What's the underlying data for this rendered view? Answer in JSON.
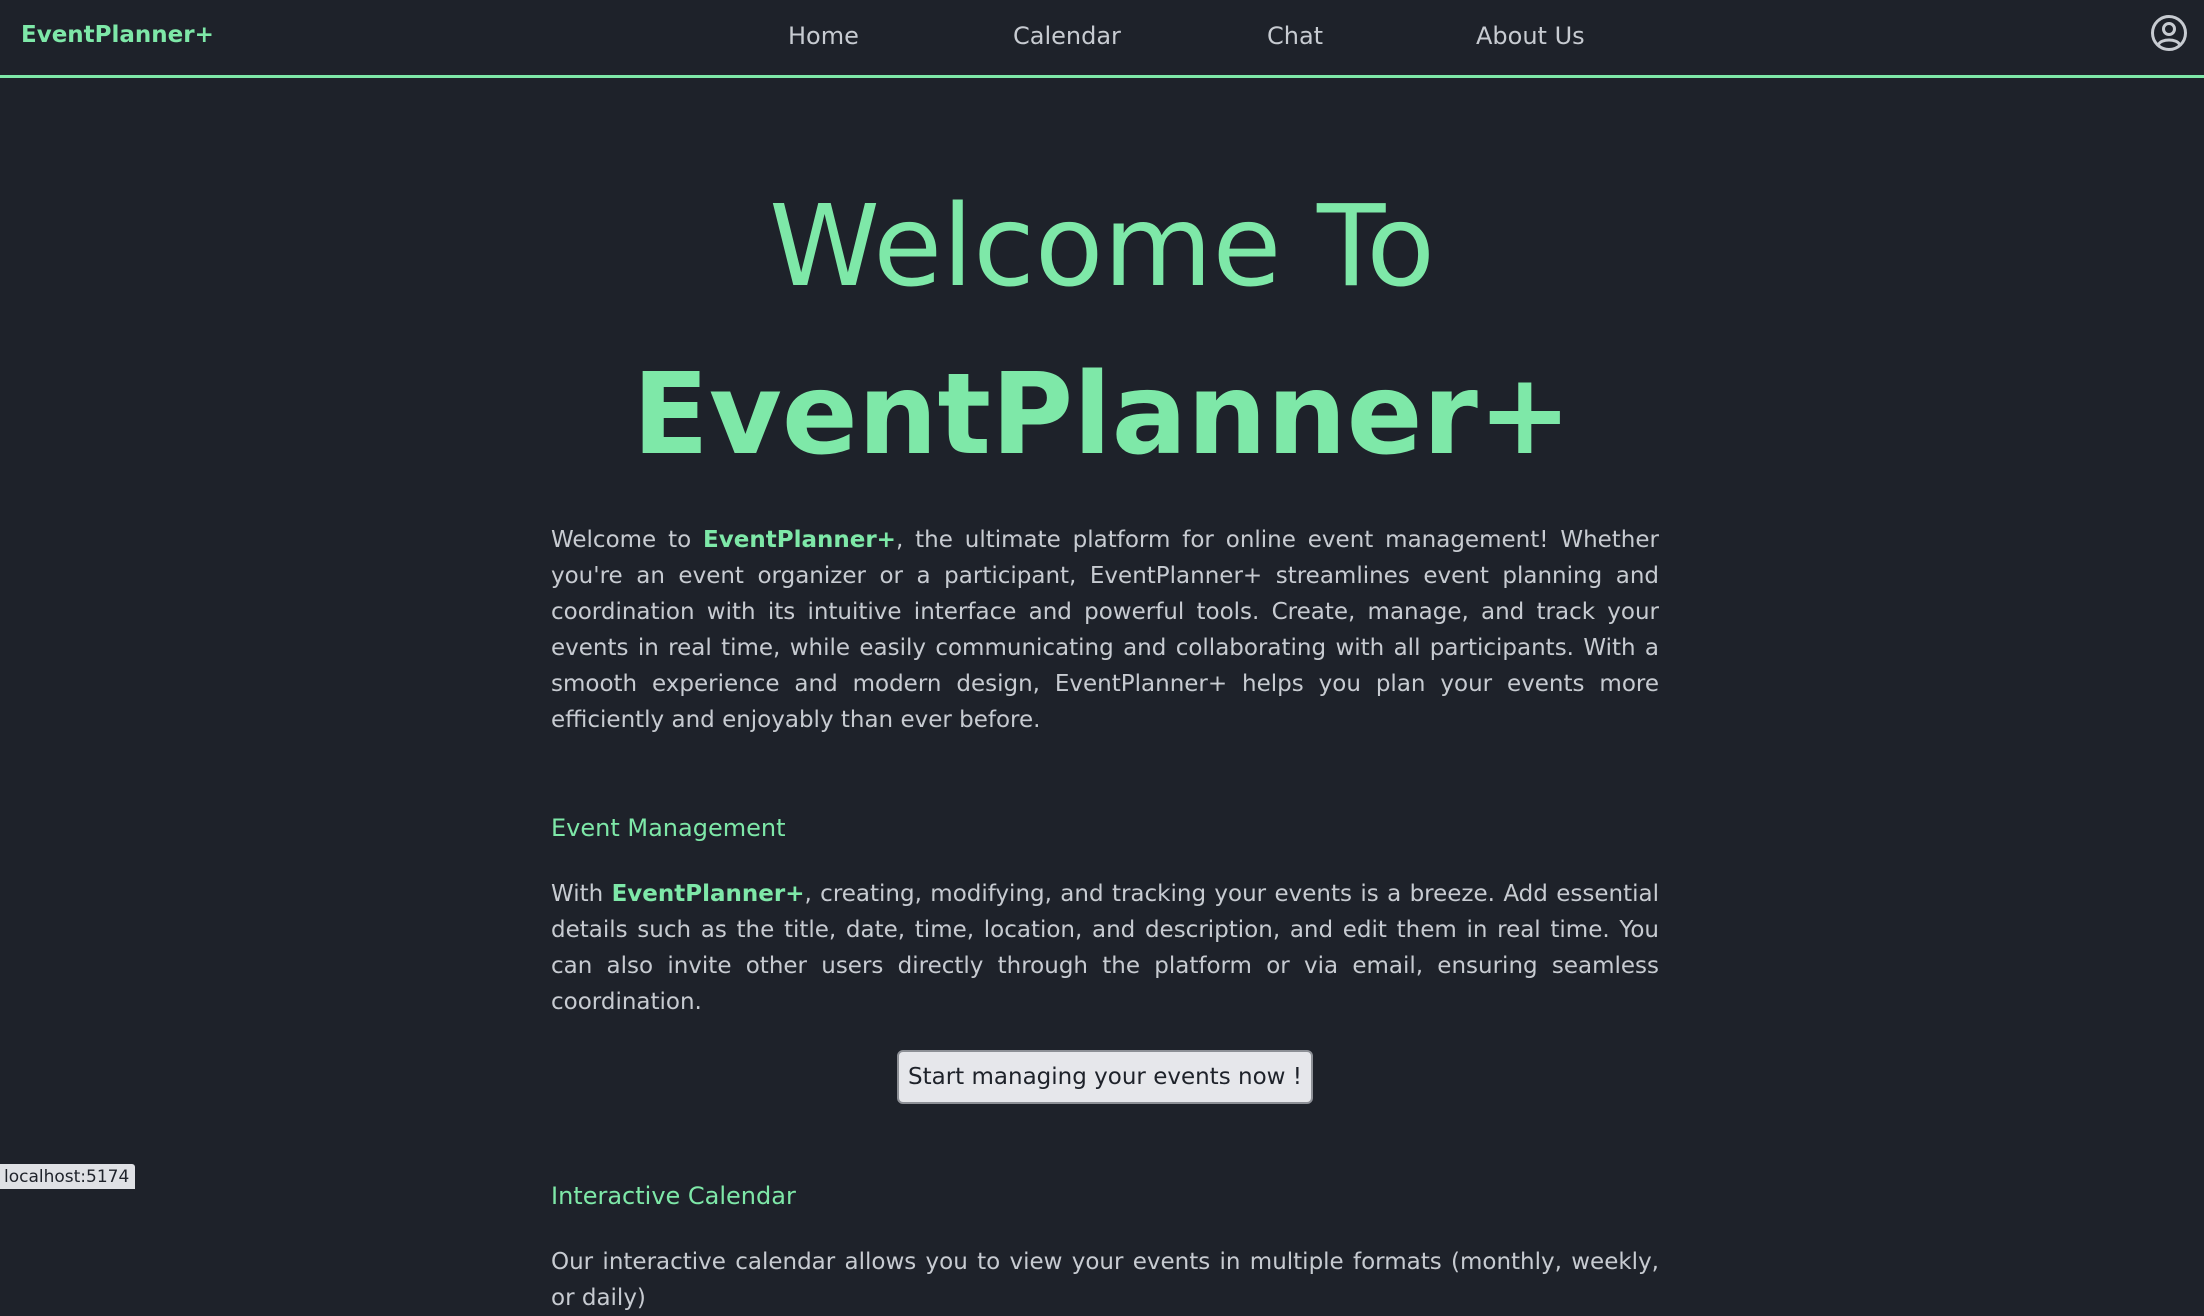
{
  "nav": {
    "brand": "EventPlanner+",
    "links": [
      "Home",
      "Calendar",
      "Chat",
      "About Us"
    ]
  },
  "hero": {
    "line1": "Welcome To",
    "line2": "EventPlanner+"
  },
  "intro": {
    "before": "Welcome to ",
    "highlight": "EventPlanner+",
    "after": ", the ultimate platform for online event management! Whether you're an event organizer or a participant, EventPlanner+ streamlines event planning and coordination with its intuitive interface and powerful tools. Create, manage, and track your events in real time, while easily communicating and collaborating with all participants. With a smooth experience and modern design, EventPlanner+ helps you plan your events more efficiently and enjoyably than ever before."
  },
  "sections": [
    {
      "title": "Event Management",
      "text_before": "With ",
      "highlight": "EventPlanner+",
      "text_after": ", creating, modifying, and tracking your events is a breeze. Add essential details such as the title, date, time, location, and description, and edit them in real time. You can also invite other users directly through the platform or via email, ensuring seamless coordination.",
      "button_label": "Start managing your events now !"
    },
    {
      "title": "Interactive Calendar",
      "text_partial": "Our interactive calendar allows you to view your events in multiple formats (monthly, weekly, or daily)"
    }
  ],
  "status_bar": {
    "url": "localhost:5174"
  },
  "colors": {
    "background": "#1e222a",
    "accent": "#7ee8a8",
    "text": "#c7cbd1"
  }
}
